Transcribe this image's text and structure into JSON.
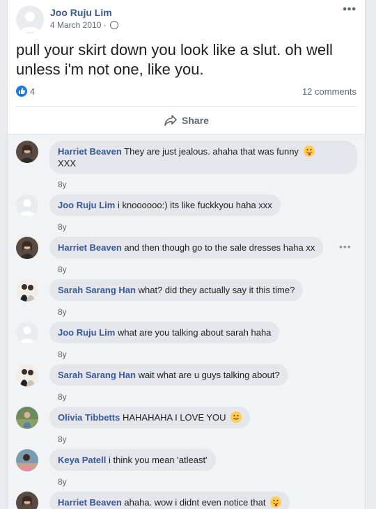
{
  "post": {
    "author": "Joo Ruju Lim",
    "date": "4 March 2010 ·",
    "text": "pull your skirt down you look like a slut. oh well unless i'm not one, like you.",
    "like_count": "4",
    "comments_count": "12 comments",
    "share_label": "Share",
    "more_label": "•••"
  },
  "comments": [
    {
      "name": "Harriet Beaven",
      "text": "They are just jealous. ahaha that was funny",
      "text2": "XXX",
      "time": "8y",
      "emoji": "tongue",
      "avatar": "photo-dark"
    },
    {
      "name": "Joo Ruju Lim",
      "text": "i knoooooo:) its like fuckkyou haha xxx",
      "time": "8y",
      "avatar": "default"
    },
    {
      "name": "Harriet Beaven",
      "text": "and then though go to the sale dresses haha xx",
      "time": "8y",
      "avatar": "photo-dark",
      "more": "•••"
    },
    {
      "name": "Sarah Sarang Han",
      "text": "what? did they actually say it this time?",
      "time": "8y",
      "avatar": "photo-light"
    },
    {
      "name": "Joo Ruju Lim",
      "text": "what are you talking about sarah haha",
      "time": "8y",
      "avatar": "default"
    },
    {
      "name": "Sarah Sarang Han",
      "text": "wait what are u guys talking about?",
      "time": "8y",
      "avatar": "photo-light"
    },
    {
      "name": "Olivia Tibbetts",
      "text": "HAHAHAHA I LOVE YOU",
      "time": "8y",
      "emoji": "smile",
      "avatar": "photo-green"
    },
    {
      "name": "Keya Patell",
      "text": "i think you mean 'atleast'",
      "time": "8y",
      "avatar": "photo-pink"
    },
    {
      "name": "Harriet Beaven",
      "text": "ahaha. wow i didnt even notice that",
      "time": "",
      "emoji": "tongue",
      "avatar": "photo-dark"
    }
  ],
  "colors": {
    "link": "#385898",
    "like": "#1877f2",
    "bubble": "#e4e6eb"
  }
}
